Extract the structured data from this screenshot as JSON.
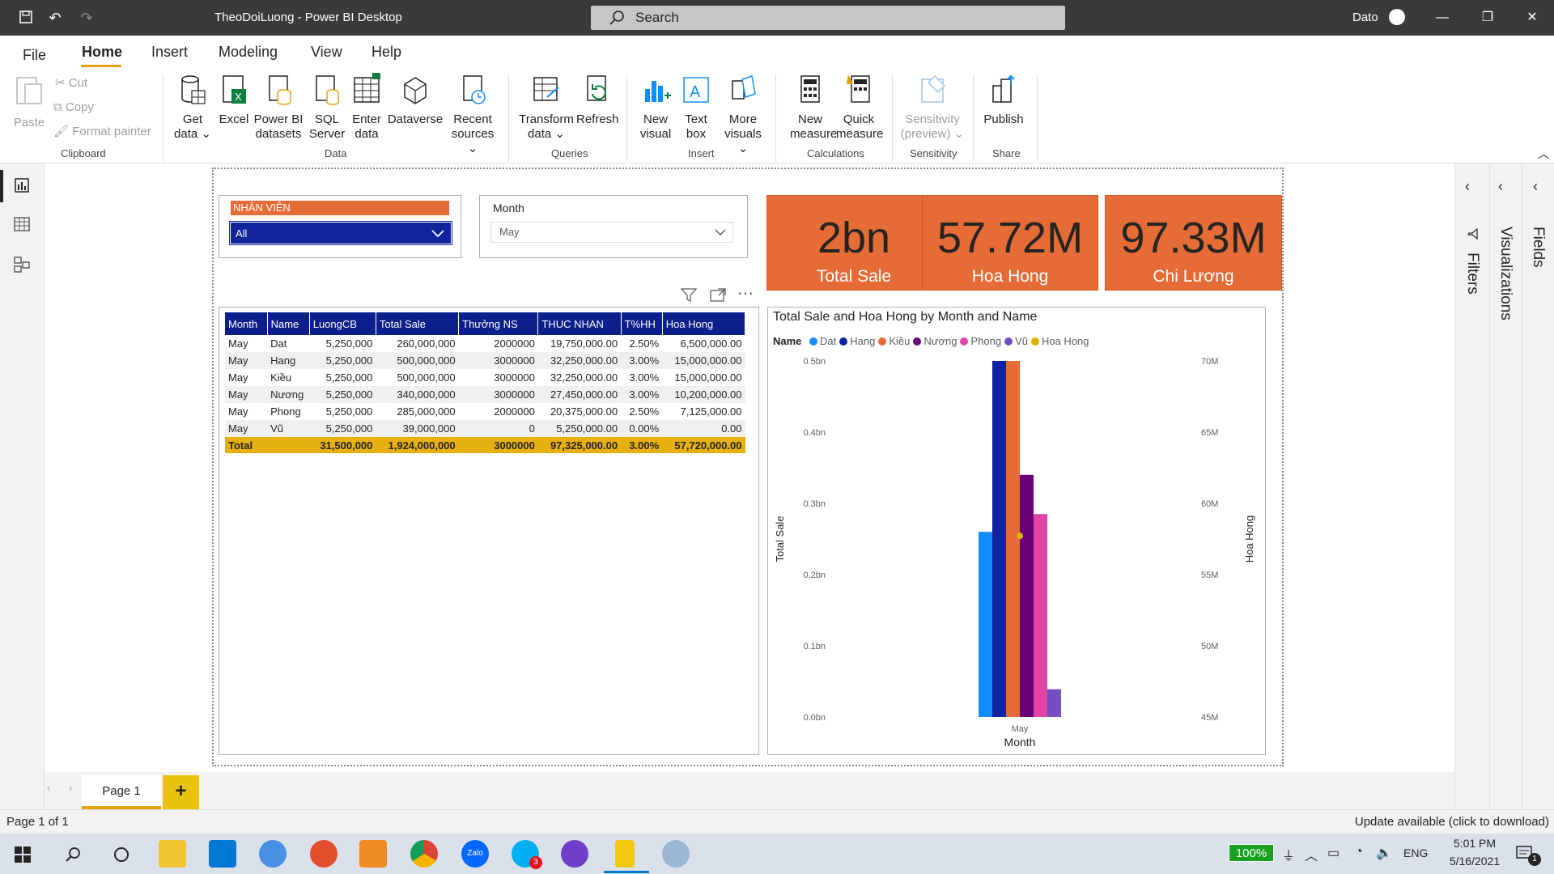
{
  "window": {
    "title": "TheoDoiLuong - Power BI Desktop",
    "search_placeholder": "Search",
    "user": "Dato"
  },
  "menu": {
    "file": "File",
    "home": "Home",
    "insert": "Insert",
    "modeling": "Modeling",
    "view": "View",
    "help": "Help"
  },
  "ribbon": {
    "paste": "Paste",
    "cut": "Cut",
    "copy": "Copy",
    "format_painter": "Format painter",
    "get_data": [
      "Get",
      "data"
    ],
    "excel": "Excel",
    "powerbi_datasets": [
      "Power BI",
      "datasets"
    ],
    "sql_server": [
      "SQL",
      "Server"
    ],
    "enter_data": [
      "Enter",
      "data"
    ],
    "dataverse": "Dataverse",
    "recent_sources": [
      "Recent",
      "sources"
    ],
    "transform_data": [
      "Transform",
      "data"
    ],
    "refresh": "Refresh",
    "new_visual": [
      "New",
      "visual"
    ],
    "text_box": [
      "Text",
      "box"
    ],
    "more_visuals": [
      "More",
      "visuals"
    ],
    "new_measure": [
      "New",
      "measure"
    ],
    "quick_measure": [
      "Quick",
      "measure"
    ],
    "sensitivity": [
      "Sensitivity",
      "(preview)"
    ],
    "publish": "Publish",
    "groups": {
      "clipboard": "Clipboard",
      "data": "Data",
      "queries": "Queries",
      "insert": "Insert",
      "calculations": "Calculations",
      "sensitivity": "Sensitivity",
      "share": "Share"
    }
  },
  "slicer_employee": {
    "title": "NHÂN VIÊN",
    "value": "All"
  },
  "slicer_month": {
    "title": "Month",
    "value": "May"
  },
  "kpis": [
    {
      "value": "2bn",
      "label": "Total Sale"
    },
    {
      "value": "57.72M",
      "label": "Hoa Hong"
    },
    {
      "value": "97.33M",
      "label": "Chi Lương"
    }
  ],
  "matrix": {
    "headers": [
      "Month",
      "Name",
      "LuongCB",
      "Total Sale",
      "Thưởng NS",
      "THUC NHAN",
      "T%HH",
      "Hoa Hong"
    ],
    "rows": [
      [
        "May",
        "Dat",
        "5,250,000",
        "260,000,000",
        "2000000",
        "19,750,000.00",
        "2.50%",
        "6,500,000.00"
      ],
      [
        "May",
        "Hang",
        "5,250,000",
        "500,000,000",
        "3000000",
        "32,250,000.00",
        "3.00%",
        "15,000,000.00"
      ],
      [
        "May",
        "Kiều",
        "5,250,000",
        "500,000,000",
        "3000000",
        "32,250,000.00",
        "3.00%",
        "15,000,000.00"
      ],
      [
        "May",
        "Nương",
        "5,250,000",
        "340,000,000",
        "3000000",
        "27,450,000.00",
        "3.00%",
        "10,200,000.00"
      ],
      [
        "May",
        "Phong",
        "5,250,000",
        "285,000,000",
        "2000000",
        "20,375,000.00",
        "2.50%",
        "7,125,000.00"
      ],
      [
        "May",
        "Vũ",
        "5,250,000",
        "39,000,000",
        "0",
        "5,250,000.00",
        "0.00%",
        "0.00"
      ]
    ],
    "total": [
      "Total",
      "",
      "31,500,000",
      "1,924,000,000",
      "3000000",
      "97,325,000.00",
      "3.00%",
      "57,720,000.00"
    ]
  },
  "chart_data": {
    "type": "bar",
    "title": "Total Sale and Hoa Hong by Month and Name",
    "legend_title": "Name",
    "legend_placement": "top-left",
    "categories": [
      "May"
    ],
    "xlabel": "Month",
    "ylabel": "Total Sale",
    "y2label": "Hoa Hong",
    "ylim": [
      0,
      0.5
    ],
    "y_ticks": [
      "0.0bn",
      "0.1bn",
      "0.2bn",
      "0.3bn",
      "0.4bn",
      "0.5bn"
    ],
    "y2lim": [
      45,
      70
    ],
    "y2_ticks": [
      "45M",
      "50M",
      "55M",
      "60M",
      "65M",
      "70M"
    ],
    "series": [
      {
        "name": "Dat",
        "color": "#118dff",
        "values": [
          0.26
        ]
      },
      {
        "name": "Hang",
        "color": "#12239e",
        "values": [
          0.5
        ]
      },
      {
        "name": "Kiều",
        "color": "#e66c37",
        "values": [
          0.5
        ]
      },
      {
        "name": "Nương",
        "color": "#6b007b",
        "values": [
          0.34
        ]
      },
      {
        "name": "Phong",
        "color": "#e044a7",
        "values": [
          0.285
        ]
      },
      {
        "name": "Vũ",
        "color": "#744ec2",
        "values": [
          0.039
        ]
      }
    ],
    "line_series": {
      "name": "Hoa Hong",
      "color": "#d9b300",
      "values": [
        57.72
      ]
    }
  },
  "right_panes": {
    "filters": "Filters",
    "visualizations": "Visualizations",
    "fields": "Fields"
  },
  "pages": {
    "page1": "Page 1",
    "add": "+"
  },
  "status": {
    "left": "Page 1 of 1",
    "right": "Update available (click to download)"
  },
  "taskbar": {
    "battery": "100%",
    "lang": "ENG",
    "time": "5:01 PM",
    "date": "5/16/2021",
    "notif_count": "1",
    "skype_badge": "3"
  }
}
